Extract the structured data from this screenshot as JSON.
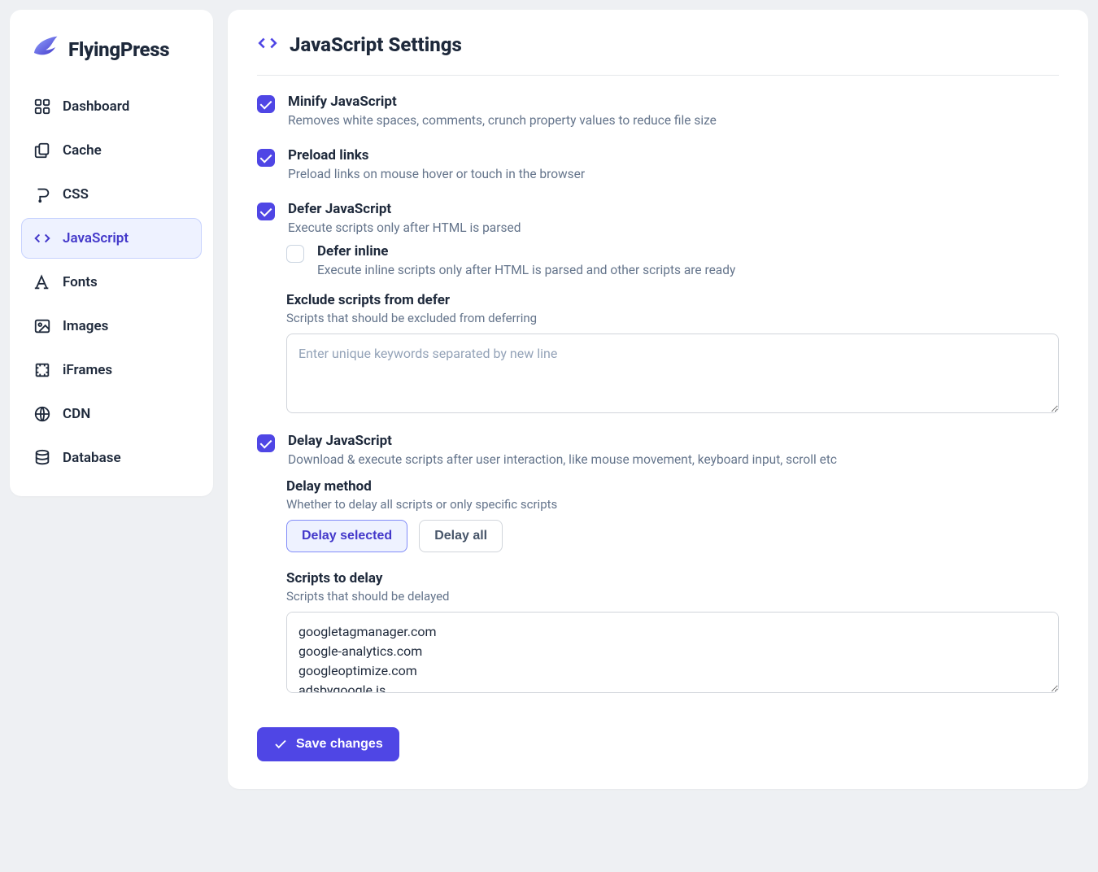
{
  "brand": {
    "name": "FlyingPress"
  },
  "sidebar": {
    "items": [
      {
        "label": "Dashboard",
        "icon": "dashboard-icon",
        "active": false
      },
      {
        "label": "Cache",
        "icon": "cache-icon",
        "active": false
      },
      {
        "label": "CSS",
        "icon": "css-icon",
        "active": false
      },
      {
        "label": "JavaScript",
        "icon": "code-icon",
        "active": true
      },
      {
        "label": "Fonts",
        "icon": "fonts-icon",
        "active": false
      },
      {
        "label": "Images",
        "icon": "images-icon",
        "active": false
      },
      {
        "label": "iFrames",
        "icon": "iframes-icon",
        "active": false
      },
      {
        "label": "CDN",
        "icon": "cdn-icon",
        "active": false
      },
      {
        "label": "Database",
        "icon": "database-icon",
        "active": false
      }
    ]
  },
  "page": {
    "title": "JavaScript Settings",
    "settings": {
      "minify": {
        "label": "Minify JavaScript",
        "desc": "Removes white spaces, comments, crunch property values to reduce file size",
        "checked": true
      },
      "preload": {
        "label": "Preload links",
        "desc": "Preload links on mouse hover or touch in the browser",
        "checked": true
      },
      "defer": {
        "label": "Defer JavaScript",
        "desc": "Execute scripts only after HTML is parsed",
        "checked": true,
        "inline": {
          "label": "Defer inline",
          "desc": "Execute inline scripts only after HTML is parsed and other scripts are ready",
          "checked": false
        },
        "exclude": {
          "heading": "Exclude scripts from defer",
          "desc": "Scripts that should be excluded from deferring",
          "placeholder": "Enter unique keywords separated by new line",
          "value": ""
        }
      },
      "delay": {
        "label": "Delay JavaScript",
        "desc": "Download & execute scripts after user interaction, like mouse movement, keyboard input, scroll etc",
        "checked": true,
        "method": {
          "heading": "Delay method",
          "desc": "Whether to delay all scripts or only specific scripts",
          "options": [
            {
              "label": "Delay selected",
              "selected": true
            },
            {
              "label": "Delay all",
              "selected": false
            }
          ]
        },
        "scripts": {
          "heading": "Scripts to delay",
          "desc": "Scripts that should be delayed",
          "value": "googletagmanager.com\ngoogle-analytics.com\ngoogleoptimize.com\nadsbygoogle.js"
        }
      }
    },
    "save_label": "Save changes"
  }
}
